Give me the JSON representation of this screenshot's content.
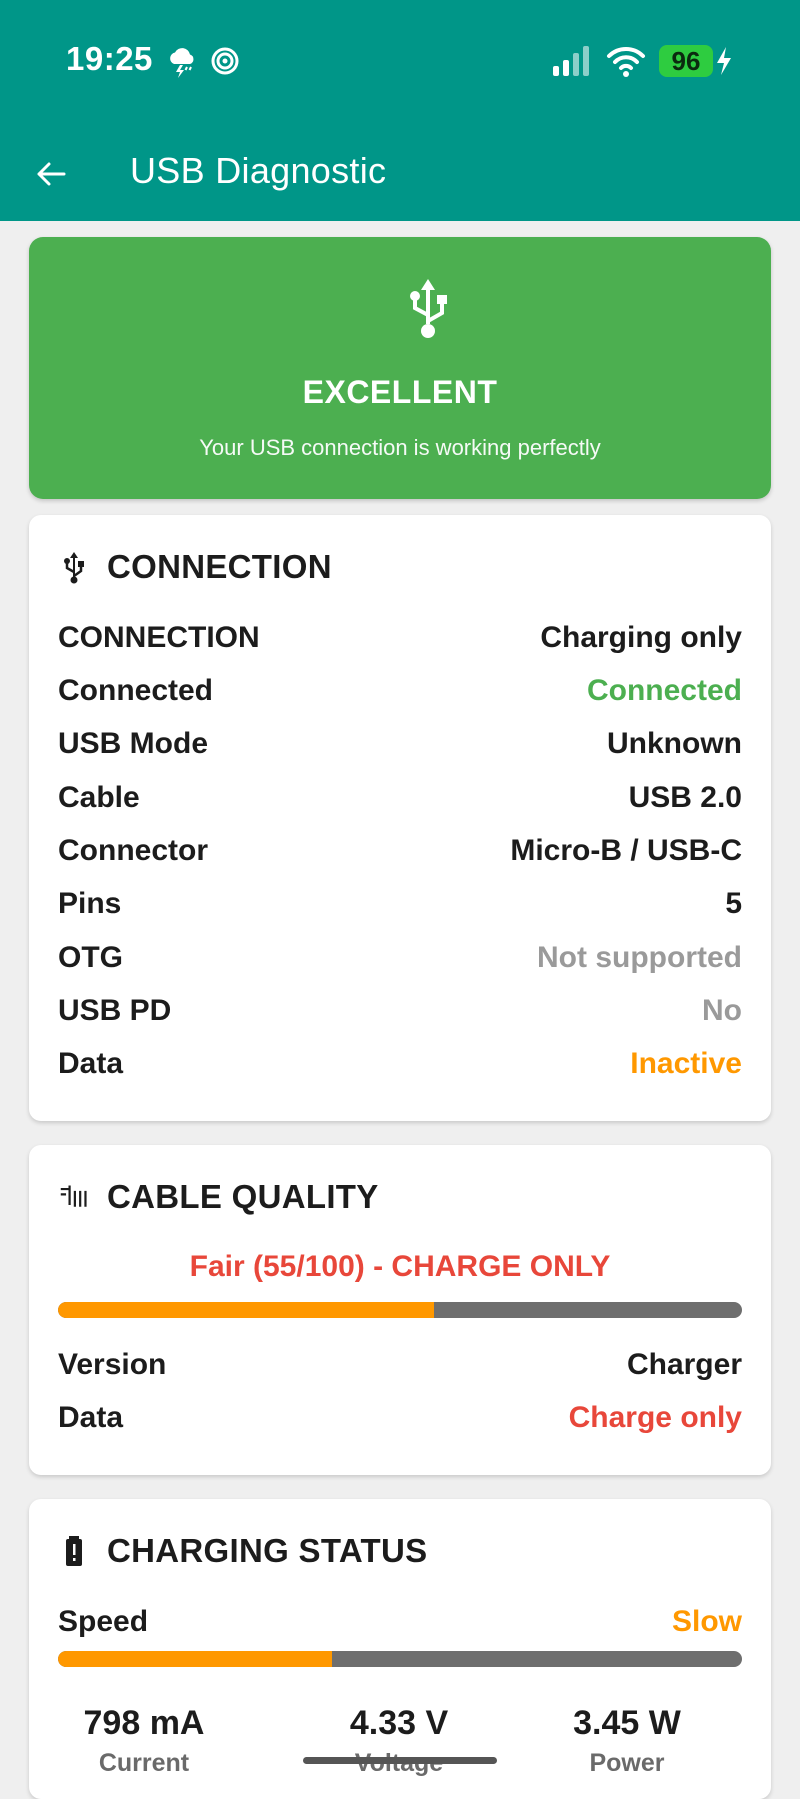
{
  "status_bar": {
    "time": "19:25",
    "battery": "96"
  },
  "app_bar": {
    "title": "USB Diagnostic"
  },
  "hero": {
    "status": "EXCELLENT",
    "subtitle": "Your USB connection is working perfectly",
    "color": "#4caf50"
  },
  "connection": {
    "title": "CONNECTION",
    "rows": [
      {
        "label": "CONNECTION",
        "value": "Charging only"
      },
      {
        "label": "Connected",
        "value": "Connected"
      },
      {
        "label": "USB Mode",
        "value": "Unknown"
      },
      {
        "label": "Cable",
        "value": "USB 2.0"
      },
      {
        "label": "Connector",
        "value": "Micro-B / USB-C"
      },
      {
        "label": "Pins",
        "value": "5"
      },
      {
        "label": "OTG",
        "value": "Not supported"
      },
      {
        "label": "USB PD",
        "value": "No"
      },
      {
        "label": "Data",
        "value": "Inactive"
      }
    ]
  },
  "cable_quality": {
    "title": "CABLE QUALITY",
    "summary": "Fair (55/100) - CHARGE ONLY",
    "progress": 0.55,
    "rows": [
      {
        "label": "Version",
        "value": "Charger"
      },
      {
        "label": "Data",
        "value": "Charge only"
      }
    ]
  },
  "charging_status": {
    "title": "CHARGING STATUS",
    "speed_label": "Speed",
    "speed_value": "Slow",
    "progress": 0.4,
    "stats": [
      {
        "value": "798 mA",
        "label": "Current"
      },
      {
        "value": "4.33 V",
        "label": "Voltage"
      },
      {
        "value": "3.45 W",
        "label": "Power"
      }
    ]
  },
  "colors": {
    "app_bar": "#009688",
    "accent_green": "#4caf50",
    "accent_orange": "#ff9800",
    "accent_red": "#e8473a"
  }
}
